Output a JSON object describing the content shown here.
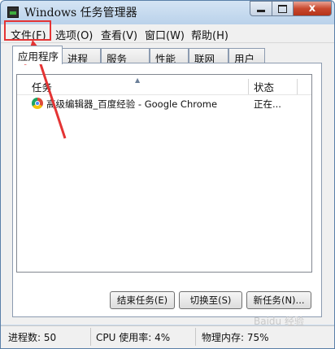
{
  "window": {
    "title": "Windows 任务管理器"
  },
  "controls": {
    "close": "x"
  },
  "menu": [
    "文件(F)",
    "选项(O)",
    "查看(V)",
    "窗口(W)",
    "帮助(H)"
  ],
  "tabs": [
    "应用程序",
    "进程",
    "服务",
    "性能",
    "联网",
    "用户"
  ],
  "list": {
    "headers": {
      "task": "任务",
      "status": "状态"
    },
    "rows": [
      {
        "task": "高级编辑器_百度经验 - Google Chrome",
        "status": "正在..."
      }
    ]
  },
  "buttons": {
    "end_task": "结束任务(E)",
    "switch_to": "切换至(S)",
    "new_task": "新任务(N)..."
  },
  "status": {
    "processes": "进程数: 50",
    "cpu": "CPU 使用率: 4%",
    "memory": "物理内存: 75%"
  },
  "highlight_color": "#e43434",
  "watermark": "Baidu 经验"
}
